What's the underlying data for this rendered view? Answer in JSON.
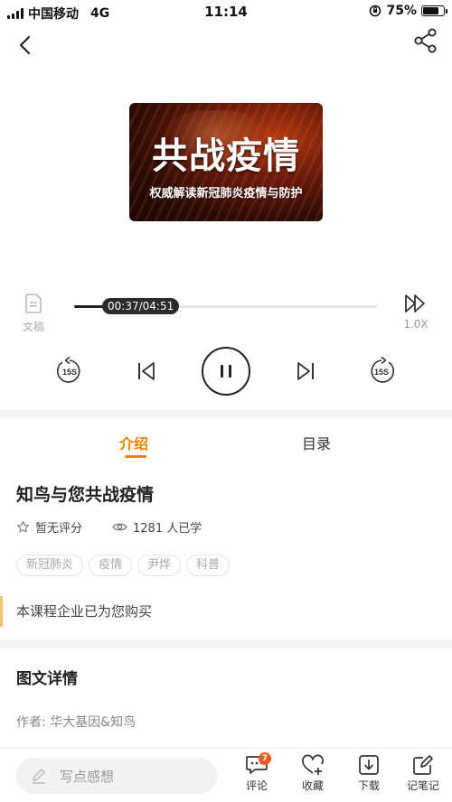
{
  "status_bar": {
    "carrier": "中国移动",
    "network": "4G",
    "time": "11:14",
    "battery_percent": "75%",
    "battery_level": 0.75
  },
  "cover": {
    "title": "共战疫情",
    "subtitle": "权威解读新冠肺炎疫情与防护"
  },
  "player": {
    "transcript_label": "文稿",
    "time_display": "00:37/04:51",
    "progress_fraction": 0.127,
    "speed_label": "1.0X",
    "rewind_label": "15S",
    "forward_label": "15S"
  },
  "tabs": [
    {
      "label": "介绍",
      "active": true
    },
    {
      "label": "目录",
      "active": false
    }
  ],
  "course": {
    "title": "知鸟与您共战疫情",
    "rating_text": "暂无评分",
    "views_text": "1281 人已学",
    "tags": [
      "新冠肺炎",
      "疫情",
      "尹烨",
      "科普"
    ],
    "purchase_notice": "本课程企业已为您购买"
  },
  "details": {
    "title": "图文详情",
    "author": "作者: 华大基因&知鸟"
  },
  "bottom_bar": {
    "comment_placeholder": "写点感想",
    "comment_label": "评论",
    "comment_badge": "7",
    "favorite_label": "收藏",
    "download_label": "下载",
    "notes_label": "记笔记"
  },
  "colors": {
    "accent": "#f08300",
    "badge": "#f05a28",
    "notice_bar": "#f2c27a"
  }
}
